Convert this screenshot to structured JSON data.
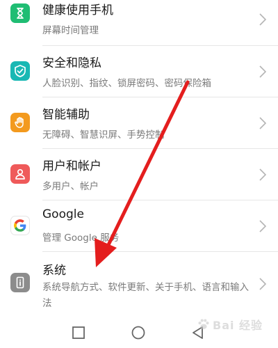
{
  "settings": {
    "items": [
      {
        "title": "健康使用手机",
        "subtitle": "屏幕时间管理",
        "icon": "hourglass-icon",
        "color": "#1fbd73"
      },
      {
        "title": "安全和隐私",
        "subtitle": "人脸识别、指纹、锁屏密码、密码保险箱",
        "icon": "shield-check-icon",
        "color": "#19b8b4"
      },
      {
        "title": "智能辅助",
        "subtitle": "无障碍、智慧识屏、手势控制",
        "icon": "hand-icon",
        "color": "#f39a1e"
      },
      {
        "title": "用户和帐户",
        "subtitle": "多用户、帐户",
        "icon": "user-icon",
        "color": "#ef5a5a"
      },
      {
        "title": "Google",
        "subtitle": "管理 Google 服务",
        "icon": "google-icon",
        "color": "#ffffff"
      },
      {
        "title": "系统",
        "subtitle": "系统导航方式、软件更新、关于手机、语言和输入法",
        "icon": "phone-info-icon",
        "color": "#8c8c8c"
      }
    ]
  },
  "navbar": {
    "buttons": [
      "back-icon",
      "home-icon",
      "recents-icon"
    ]
  },
  "watermark": {
    "text": "Bai 经验"
  },
  "annotation": {
    "color": "#e41e1e"
  }
}
